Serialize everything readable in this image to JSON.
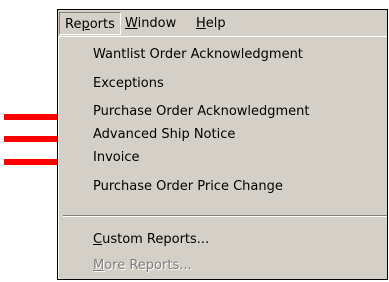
{
  "menubar": {
    "items": [
      {
        "pre": "Re",
        "key": "p",
        "post": "orts"
      },
      {
        "pre": "",
        "key": "W",
        "post": "indow"
      },
      {
        "pre": "",
        "key": "H",
        "post": "elp"
      }
    ]
  },
  "dropdown": {
    "items": [
      {
        "label": "Wantlist Order Acknowledgment"
      },
      {
        "label": "Exceptions"
      },
      {
        "label": "Purchase Order Acknowledgment"
      },
      {
        "label": "Advanced Ship Notice"
      },
      {
        "label": "Invoice"
      },
      {
        "label": "Purchase Order Price Change"
      }
    ],
    "custom_reports": {
      "key": "C",
      "post": "ustom Reports..."
    },
    "more_reports": {
      "key": "M",
      "post": "ore Reports..."
    }
  },
  "colors": {
    "menu_bg": "#d4d0c8",
    "arrow": "#ff0000",
    "disabled_text": "#808080"
  },
  "icons": [
    "arrow-right-icon"
  ]
}
